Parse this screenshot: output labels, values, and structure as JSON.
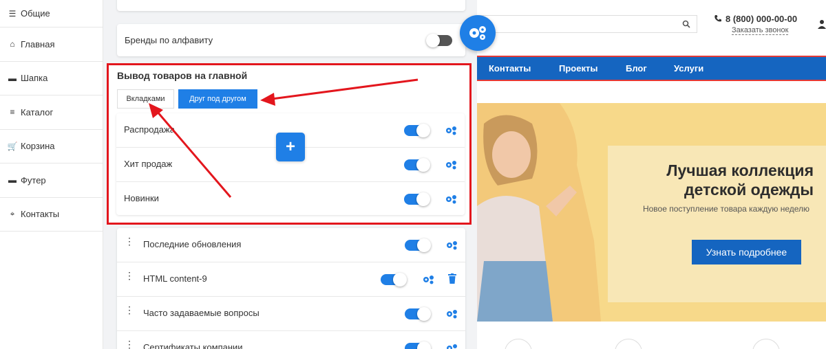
{
  "sidebar": {
    "items": [
      {
        "label": "Общие",
        "icon": "sliders-icon"
      },
      {
        "label": "Главная",
        "icon": "home-icon"
      },
      {
        "label": "Шапка",
        "icon": "header-icon"
      },
      {
        "label": "Каталог",
        "icon": "list-icon"
      },
      {
        "label": "Корзина",
        "icon": "cart-icon"
      },
      {
        "label": "Футер",
        "icon": "footer-icon"
      },
      {
        "label": "Контакты",
        "icon": "map-icon"
      }
    ]
  },
  "panel": {
    "brands_label": "Бренды по алфавиту",
    "products_section": {
      "title": "Вывод товаров на главной",
      "option_tabs": "Вкладками",
      "option_stacked": "Друг под другом",
      "rows": [
        {
          "label": "Распродажа",
          "enabled": true
        },
        {
          "label": "Хит продаж",
          "enabled": true
        },
        {
          "label": "Новинки",
          "enabled": true
        }
      ]
    },
    "blocks": [
      {
        "label": "Последние обновления",
        "enabled": true
      },
      {
        "label": "HTML content-9",
        "enabled": true
      },
      {
        "label": "Часто задаваемые вопросы",
        "enabled": true
      },
      {
        "label": "Сертификаты компании",
        "enabled": true
      }
    ],
    "add_label": "+"
  },
  "site": {
    "phone": "8 (800) 000-00-00",
    "callback_link": "Заказать звонок",
    "nav": [
      "Контакты",
      "Проекты",
      "Блог",
      "Услуги"
    ],
    "promo_title": "Лучшая коллекция детской одежды",
    "promo_subtitle": "Новое поступление товара каждую неделю",
    "promo_button": "Узнать подробнее"
  },
  "colors": {
    "accent": "#1f7fe6",
    "nav": "#1565c0",
    "highlight": "#e3161d"
  }
}
